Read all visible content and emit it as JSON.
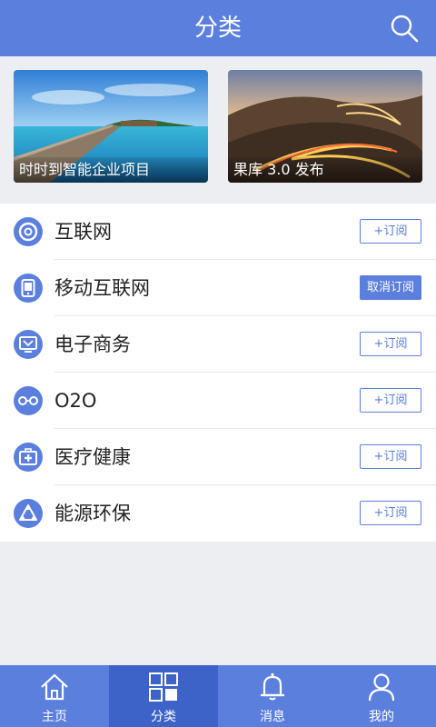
{
  "header": {
    "title": "分类",
    "search_icon": "search-icon"
  },
  "banners": [
    {
      "caption": "时时到智能企业项目"
    },
    {
      "caption": "果库 3.0 发布"
    }
  ],
  "categories": [
    {
      "name": "互联网",
      "icon": "at-sign-icon",
      "action": "+订阅",
      "subscribed": false
    },
    {
      "name": "移动互联网",
      "icon": "tablet-icon",
      "action": "取消订阅",
      "subscribed": true
    },
    {
      "name": "电子商务",
      "icon": "monitor-icon",
      "action": "+订阅",
      "subscribed": false
    },
    {
      "name": "O2O",
      "icon": "link-icon",
      "action": "+订阅",
      "subscribed": false
    },
    {
      "name": "医疗健康",
      "icon": "medical-kit-icon",
      "action": "+订阅",
      "subscribed": false
    },
    {
      "name": "能源环保",
      "icon": "recycle-icon",
      "action": "+订阅",
      "subscribed": false
    }
  ],
  "tabbar": [
    {
      "label": "主页",
      "icon": "home-icon",
      "active": false
    },
    {
      "label": "分类",
      "icon": "grid-icon",
      "active": true
    },
    {
      "label": "消息",
      "icon": "bell-icon",
      "active": false
    },
    {
      "label": "我的",
      "icon": "user-icon",
      "active": false
    }
  ],
  "colors": {
    "primary": "#5b7fdc",
    "tab_active": "#3d63c9",
    "background": "#eceef2"
  }
}
